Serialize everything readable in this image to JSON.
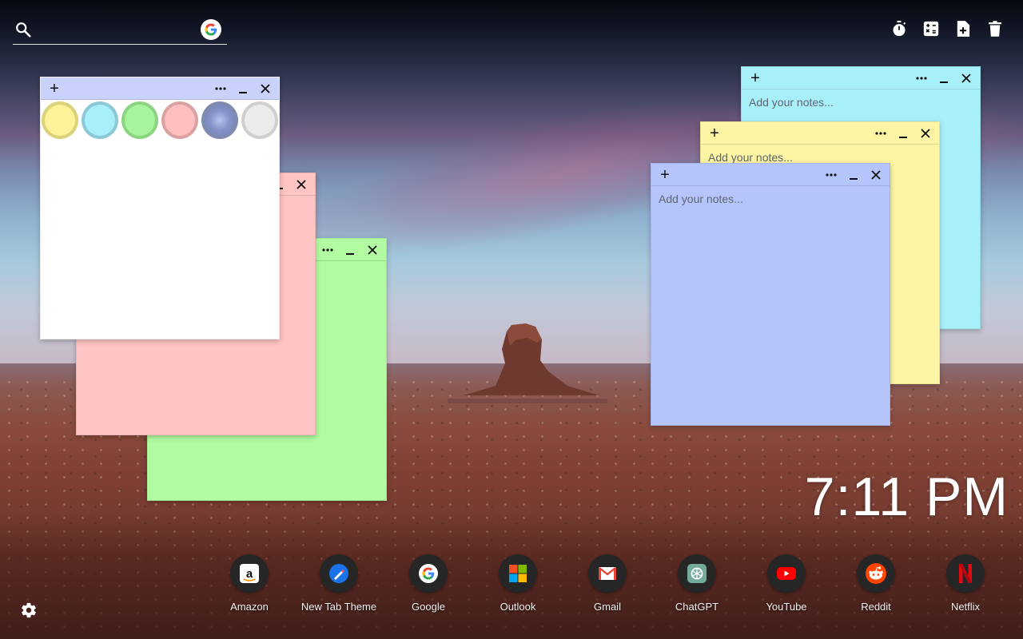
{
  "search": {
    "placeholder": "",
    "engine_icon": "google-icon"
  },
  "toolbar": {
    "buttons": [
      {
        "icon": "timer-icon"
      },
      {
        "icon": "calculator-icon"
      },
      {
        "icon": "new-note-icon"
      },
      {
        "icon": "trash-icon"
      }
    ]
  },
  "notes": {
    "placeholder": "Add your notes...",
    "add_symbol": "+",
    "more_symbol": "•••",
    "minimize_symbol": "_",
    "close_symbol": "✕",
    "colors": {
      "white": "#ffffff",
      "pink": "#ffc4c4",
      "green": "#b2fba0",
      "cyan": "#a7f0fa",
      "yellow": "#fef5a4",
      "lavender": "#b5c4fb",
      "header_white": "#c8d2fb"
    },
    "palette": [
      {
        "name": "yellow",
        "color": "#fdf29a"
      },
      {
        "name": "cyan",
        "color": "#a6effb"
      },
      {
        "name": "green",
        "color": "#a8f49e"
      },
      {
        "name": "pink",
        "color": "#ffbfc0"
      },
      {
        "name": "lavender",
        "color": "#8593c8"
      },
      {
        "name": "grey",
        "color": "#ececec"
      }
    ]
  },
  "clock": {
    "time": "7:11 PM"
  },
  "shortcuts": [
    {
      "label": "Amazon",
      "icon": "amazon-icon"
    },
    {
      "label": "New Tab Theme",
      "icon": "new-tab-theme-icon"
    },
    {
      "label": "Google",
      "icon": "google-icon"
    },
    {
      "label": "Outlook",
      "icon": "microsoft-icon"
    },
    {
      "label": "Gmail",
      "icon": "gmail-icon"
    },
    {
      "label": "ChatGPT",
      "icon": "chatgpt-icon"
    },
    {
      "label": "YouTube",
      "icon": "youtube-icon"
    },
    {
      "label": "Reddit",
      "icon": "reddit-icon"
    },
    {
      "label": "Netflix",
      "icon": "netflix-icon"
    }
  ],
  "settings": {
    "icon": "settings-icon"
  }
}
